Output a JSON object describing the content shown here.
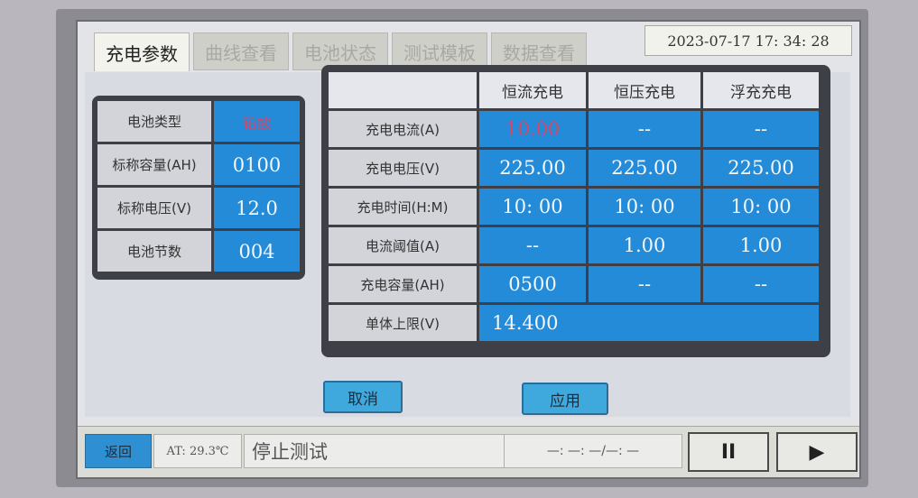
{
  "tabs": [
    "充电参数",
    "曲线查看",
    "电池状态",
    "测试模板",
    "数据查看"
  ],
  "datetime": "2023-07-17  17: 34: 28",
  "battery": {
    "rows": [
      {
        "label": "电池类型",
        "value": "铅酸"
      },
      {
        "label": "标称容量(AH)",
        "value": "0100"
      },
      {
        "label": "标称电压(V)",
        "value": "12.0"
      },
      {
        "label": "电池节数",
        "value": "004"
      }
    ]
  },
  "charge_table": {
    "headers": [
      "",
      "恒流充电",
      "恒压充电",
      "浮充充电"
    ],
    "rows": [
      {
        "label": "充电电流(A)",
        "values": [
          "10.00",
          "--",
          "--"
        ]
      },
      {
        "label": "充电电压(V)",
        "values": [
          "225.00",
          "225.00",
          "225.00"
        ]
      },
      {
        "label": "充电时间(H:M)",
        "values": [
          "10: 00",
          "10: 00",
          "10: 00"
        ]
      },
      {
        "label": "电流阈值(A)",
        "values": [
          "--",
          "1.00",
          "1.00"
        ]
      },
      {
        "label": "充电容量(AH)",
        "values": [
          "0500",
          "--",
          "--"
        ]
      },
      {
        "label": "单体上限(V)",
        "values": [
          "14.400"
        ]
      }
    ]
  },
  "buttons": {
    "cancel": "取消",
    "apply": "应用"
  },
  "footer": {
    "back": "返回",
    "temperature": "AT: 29.3℃",
    "status": "停止测试",
    "timer": "—: —: —/—: —",
    "pause": "II",
    "play": "▶"
  }
}
